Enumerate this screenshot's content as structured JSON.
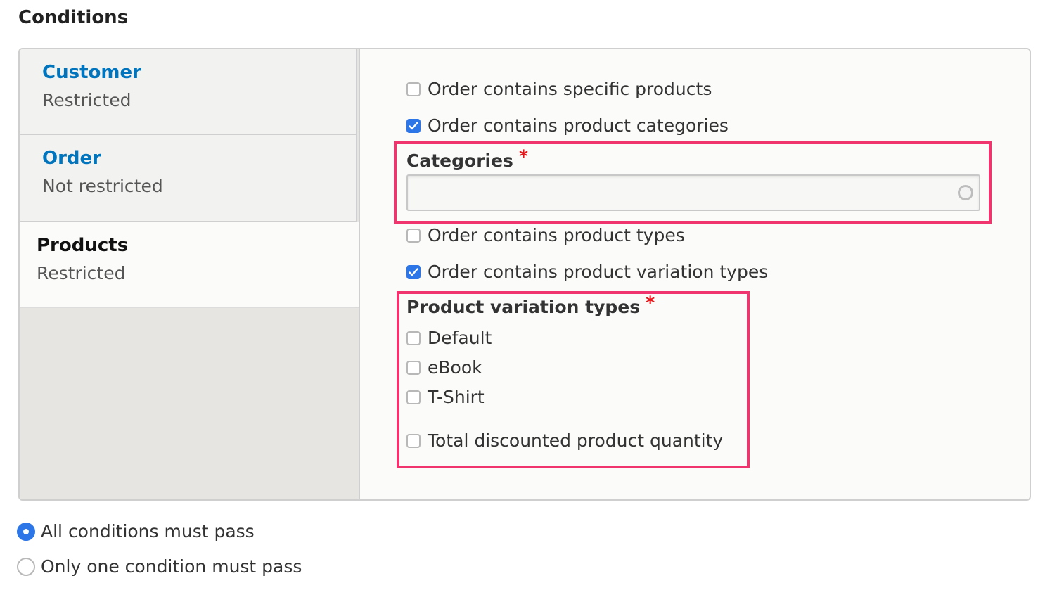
{
  "title": "Conditions",
  "tabs": [
    {
      "name": "Customer",
      "status": "Restricted"
    },
    {
      "name": "Order",
      "status": "Not restricted"
    },
    {
      "name": "Products",
      "status": "Restricted"
    }
  ],
  "options": {
    "specific_products": {
      "label": "Order contains specific products",
      "checked": false
    },
    "product_categories": {
      "label": "Order contains product categories",
      "checked": true
    },
    "product_types": {
      "label": "Order contains product types",
      "checked": false
    },
    "variation_types": {
      "label": "Order contains product variation types",
      "checked": true
    },
    "total_quantity": {
      "label": "Total discounted product quantity",
      "checked": false
    }
  },
  "categories_field": {
    "label": "Categories",
    "required_marker": "*",
    "value": ""
  },
  "variation_types_field": {
    "label": "Product variation types",
    "required_marker": "*",
    "items": [
      {
        "label": "Default",
        "checked": false
      },
      {
        "label": "eBook",
        "checked": false
      },
      {
        "label": "T-Shirt",
        "checked": false
      }
    ]
  },
  "operator": {
    "all": {
      "label": "All conditions must pass",
      "selected": true
    },
    "one": {
      "label": "Only one condition must pass",
      "selected": false
    }
  },
  "colors": {
    "accent": "#2d76e8",
    "link": "#0074bd",
    "highlight": "#f0346e",
    "required": "#e5151a"
  }
}
